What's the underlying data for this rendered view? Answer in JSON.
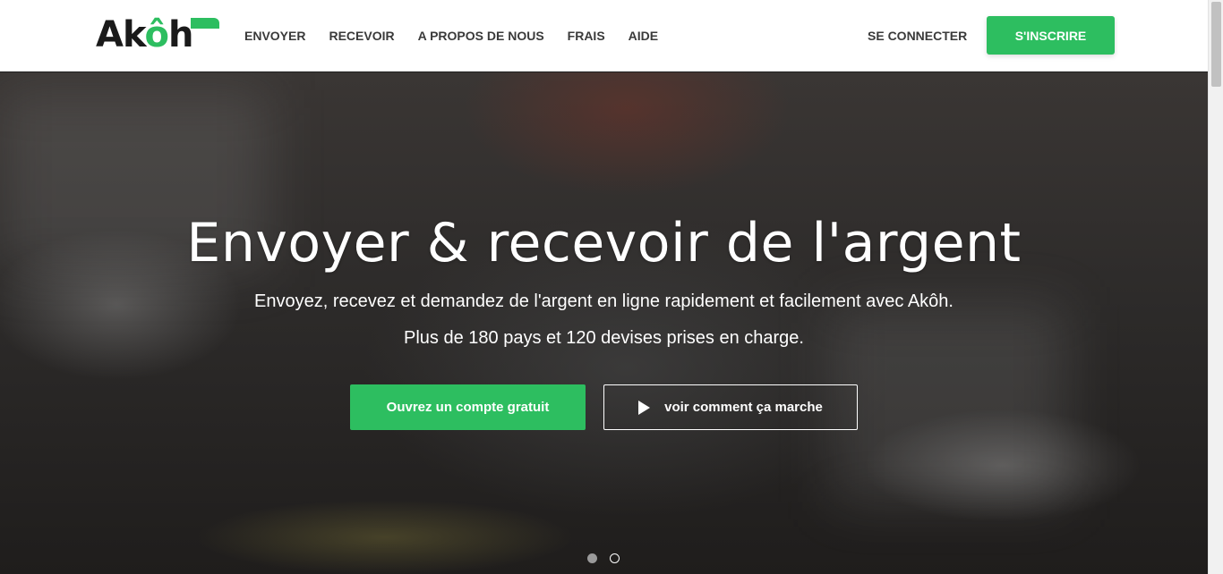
{
  "brand": {
    "logo_text_a": "Ak",
    "logo_text_o": "ô",
    "logo_text_h": "h",
    "accent_color": "#2dbe60"
  },
  "nav": {
    "items": [
      {
        "label": "ENVOYER"
      },
      {
        "label": "RECEVOIR"
      },
      {
        "label": "A PROPOS DE NOUS"
      },
      {
        "label": "FRAIS"
      },
      {
        "label": "AIDE"
      }
    ],
    "login_label": "SE CONNECTER",
    "signup_label": "S'INSCRIRE"
  },
  "hero": {
    "title": "Envoyer & recevoir de l'argent",
    "subtitle_line1": "Envoyez, recevez et demandez de l'argent en ligne rapidement et facilement avec Akôh.",
    "subtitle_line2": "Plus de 180 pays et 120 devises prises en charge.",
    "primary_cta": "Ouvrez un compte gratuit",
    "secondary_cta": "voir comment ça marche",
    "secondary_icon": "play-icon",
    "carousel_slides": 2,
    "carousel_active": 1
  }
}
